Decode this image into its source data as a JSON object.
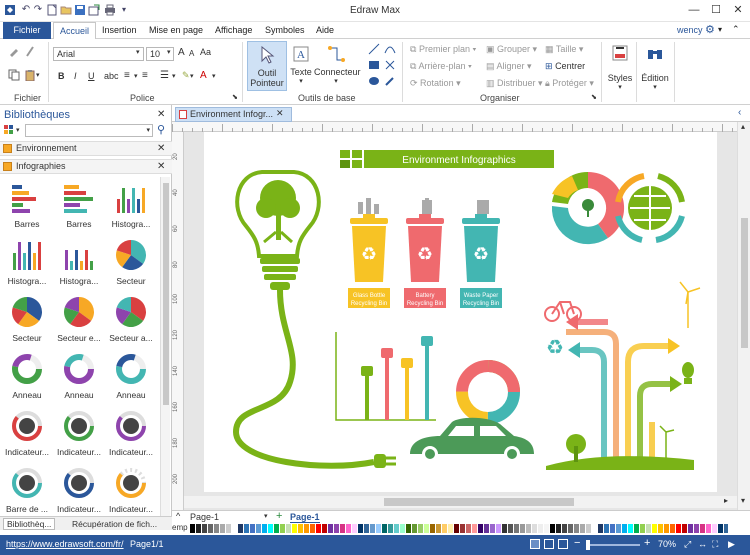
{
  "app": {
    "title": "Edraw Max"
  },
  "user": {
    "name": "wency"
  },
  "menu": {
    "file": "Fichier",
    "tabs": [
      "Accueil",
      "Insertion",
      "Mise en page",
      "Affichage",
      "Symboles",
      "Aide"
    ]
  },
  "ribbon": {
    "groups": {
      "fichier": "Fichier",
      "police": "Police",
      "outils": "Outils de base",
      "organiser": "Organiser"
    },
    "font_name": "Arial",
    "font_size": "10",
    "tool_pointer": [
      "Outil",
      "Pointeur"
    ],
    "tool_text": "Texte",
    "tool_connector": "Connecteur",
    "arrange": {
      "front": "Premier plan",
      "back": "Arrière-plan",
      "rotation": "Rotation",
      "group": "Grouper",
      "align": "Aligner",
      "distribute": "Distribuer",
      "size": "Taille",
      "center": "Centrer",
      "protect": "Protéger"
    },
    "styles": "Styles",
    "edition": "Édition"
  },
  "sidebar": {
    "title": "Bibliothèques",
    "section_env": "Environnement",
    "section_info": "Infographies",
    "shapes": [
      "Barres",
      "Barres",
      "Histogra...",
      "Histogra...",
      "Histogra...",
      "Secteur",
      "Secteur",
      "Secteur e...",
      "Secteur a...",
      "Anneau",
      "Anneau",
      "Anneau",
      "Indicateur...",
      "Indicateur...",
      "Indicateur...",
      "Barre de ...",
      "Indicateur...",
      "Indicateur..."
    ],
    "bottom_tabs": [
      "Bibliothèq...",
      "Récupération de fich..."
    ]
  },
  "document": {
    "tab": "Environment Infogr...",
    "page_tab": "Page-1",
    "page_active": "Page-1",
    "page_text_stub": "emp"
  },
  "infographic": {
    "title": "Environment Infographics",
    "bins": [
      {
        "line1": "Glass Bottle",
        "line2": "Recycling Bin",
        "color": "#f7c325"
      },
      {
        "line1": "Battery",
        "line2": "Recycling Bin",
        "color": "#ef6a6e"
      },
      {
        "line1": "Waste Paper",
        "line2": "Recycling Bin",
        "color": "#43b6b2"
      }
    ],
    "colors": {
      "green": "#7ab317",
      "yellow": "#f7c325",
      "red": "#ef6a6e",
      "teal": "#43b6b2",
      "orange": "#f39c5a"
    }
  },
  "status": {
    "url": "https://www.edrawsoft.com/fr/",
    "page": "Page1/1",
    "zoom": "70%"
  },
  "ruler_marks": [
    "20",
    "40",
    "60",
    "80",
    "100",
    "120",
    "140",
    "160",
    "180",
    "200"
  ]
}
